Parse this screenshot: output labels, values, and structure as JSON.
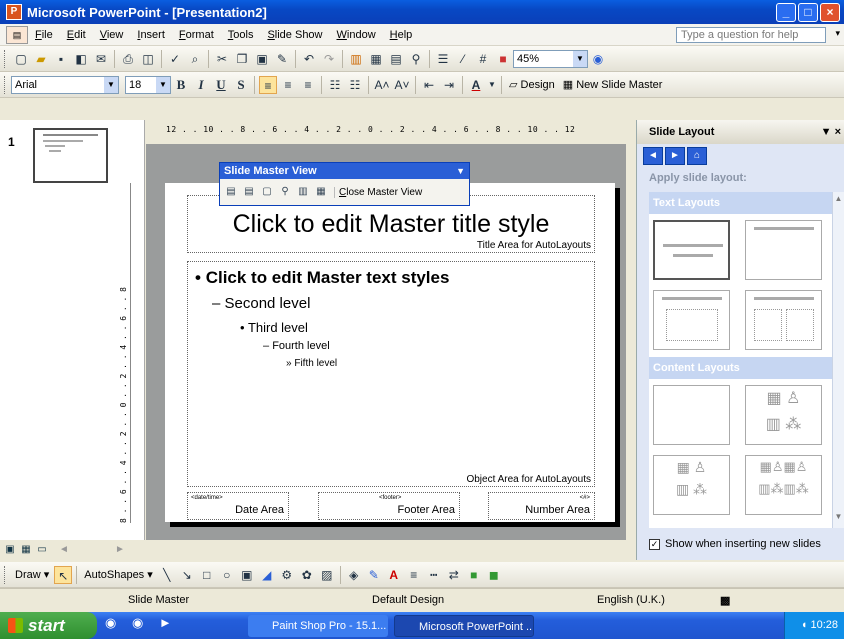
{
  "window": {
    "title": "Microsoft PowerPoint - [Presentation2]"
  },
  "menu": {
    "items": [
      "File",
      "Edit",
      "View",
      "Insert",
      "Format",
      "Tools",
      "Slide Show",
      "Window",
      "Help"
    ],
    "help_placeholder": "Type a question for help"
  },
  "standard_toolbar": {
    "zoom": "45%"
  },
  "formatting_toolbar": {
    "font": "Arial",
    "size": "18",
    "design_label": "Design",
    "new_master_label": "New Slide Master"
  },
  "slides_pane": {
    "thumbnail_number": "1"
  },
  "ruler": {
    "horizontal": "12 . . 10 . . 8 . . 6 . . 4 . . 2 . . 0 . . 2 . . 4 . . 6 . . 8 . . 10 . . 12",
    "vertical": "8 . . 6 . . 4 . . 2 . . 0 . . 2 . . 4 . . 6 . . 8"
  },
  "slide_master_view": {
    "title": "Slide Master View",
    "close_label": "Close Master View"
  },
  "slide": {
    "title": "Click to edit Master title style",
    "title_area_caption": "Title Area for AutoLayouts",
    "level1": "Click to edit Master text styles",
    "level2": "Second level",
    "level3": "Third level",
    "level4": "Fourth level",
    "level5": "Fifth level",
    "object_area_caption": "Object Area for AutoLayouts",
    "date_tag": "<date/time>",
    "date_label": "Date Area",
    "footer_tag": "<footer>",
    "footer_label": "Footer Area",
    "number_tag": "<#>",
    "number_label": "Number Area"
  },
  "task_pane": {
    "title": "Slide Layout",
    "apply_label": "Apply slide layout:",
    "text_layouts": "Text Layouts",
    "content_layouts": "Content Layouts",
    "show_checkbox": "Show when inserting new slides",
    "show_checked": true
  },
  "drawing_toolbar": {
    "draw_label": "Draw",
    "autoshapes_label": "AutoShapes"
  },
  "status": {
    "view": "Slide Master",
    "design": "Default Design",
    "language": "English (U.K.)"
  },
  "taskbar": {
    "start": "start",
    "buttons": [
      "Paint Shop Pro - 15.1...",
      "Microsoft PowerPoint ..."
    ],
    "clock": "10:28"
  },
  "colors": {
    "titlebar": "#0a5ee0",
    "taskbar": "#245edb",
    "start": "#2f8f2f",
    "workspace": "#9a9c9c"
  }
}
